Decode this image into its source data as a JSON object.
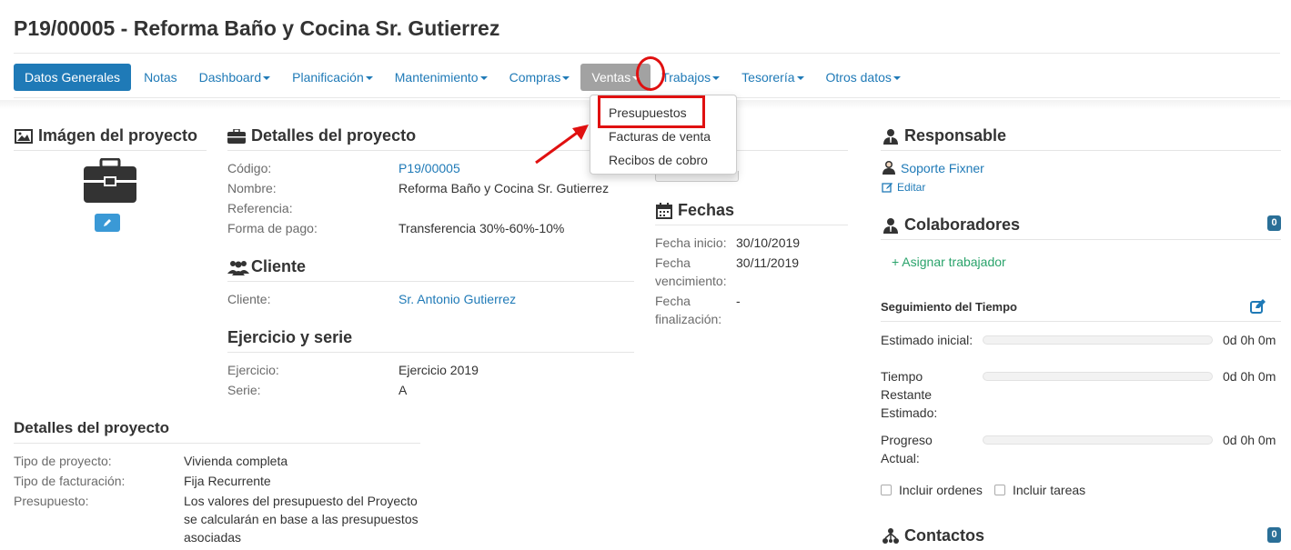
{
  "page": {
    "title": "P19/00005 - Reforma Baño y Cocina Sr. Gutierrez"
  },
  "nav": {
    "items": [
      {
        "label": "Datos Generales"
      },
      {
        "label": "Notas"
      },
      {
        "label": "Dashboard"
      },
      {
        "label": "Planificación"
      },
      {
        "label": "Mantenimiento"
      },
      {
        "label": "Compras"
      },
      {
        "label": "Ventas"
      },
      {
        "label": "Trabajos"
      },
      {
        "label": "Tesorería"
      },
      {
        "label": "Otros datos"
      }
    ]
  },
  "ventas_menu": {
    "items": [
      "Presupuestos",
      "Facturas de venta",
      "Recibos de cobro"
    ]
  },
  "imagen": {
    "heading": "Imágen del proyecto"
  },
  "detalles": {
    "heading": "Detalles del proyecto",
    "codigo_label": "Código:",
    "codigo": "P19/00005",
    "nombre_label": "Nombre:",
    "nombre": "Reforma Baño y Cocina Sr. Gutierrez",
    "referencia_label": "Referencia:",
    "pago_label": "Forma de pago:",
    "pago": "Transferencia 30%-60%-10%"
  },
  "cliente": {
    "heading": "Cliente",
    "label": "Cliente:",
    "value": "Sr. Antonio Gutierrez"
  },
  "ejercicio": {
    "heading": "Ejercicio y serie",
    "ejercicio_label": "Ejercicio:",
    "ejercicio": "Ejercicio 2019",
    "serie_label": "Serie:",
    "serie": "A"
  },
  "detalles2": {
    "heading": "Detalles del proyecto",
    "tipo_label": "Tipo de proyecto:",
    "tipo": "Vivienda completa",
    "facturacion_label": "Tipo de facturación:",
    "facturacion": "Fija Recurrente",
    "presupuesto_label": "Presupuesto:",
    "presupuesto_l1": "Los valores del presupuesto del Proyecto",
    "presupuesto_l2": "se calcularán en base a las presupuestos",
    "presupuesto_l3": "asociadas"
  },
  "fechas": {
    "heading": "Fechas",
    "inicio_label": "Fecha inicio:",
    "inicio": "30/10/2019",
    "venc_l1": "Fecha",
    "venc_l2": "vencimiento:",
    "venc": "30/11/2019",
    "fin_l1": "Fecha",
    "fin_l2": "finalización:",
    "fin": "-"
  },
  "responsable": {
    "heading": "Responsable",
    "name": "Soporte Fixner",
    "edit": "Editar"
  },
  "colaboradores": {
    "heading": "Colaboradores",
    "count": "0",
    "add": "+ Asignar trabajador"
  },
  "tiempo": {
    "heading": "Seguimiento del Tiempo",
    "estimado_label": "Estimado inicial:",
    "estimado": "0d 0h 0m",
    "estimado_progress": 0,
    "restante_l1": "Tiempo",
    "restante_l2": "Restante",
    "restante_l3": "Estimado:",
    "restante": "0d 0h 0m",
    "restante_progress": 0,
    "progreso_l1": "Progreso",
    "progreso_l2": "Actual:",
    "progreso": "0d 0h 0m",
    "progreso_progress": 0,
    "incluir_ordenes": "Incluir ordenes",
    "incluir_tareas": "Incluir tareas"
  },
  "contactos": {
    "heading": "Contactos",
    "count": "0"
  },
  "colors": {
    "brand": "#1f7ab7",
    "active_tab": "#1f7ab7",
    "open_tab": "#a2a2a2",
    "highlight": "#e01010",
    "add_link": "#2aa36b",
    "badge": "#2a6f97"
  }
}
